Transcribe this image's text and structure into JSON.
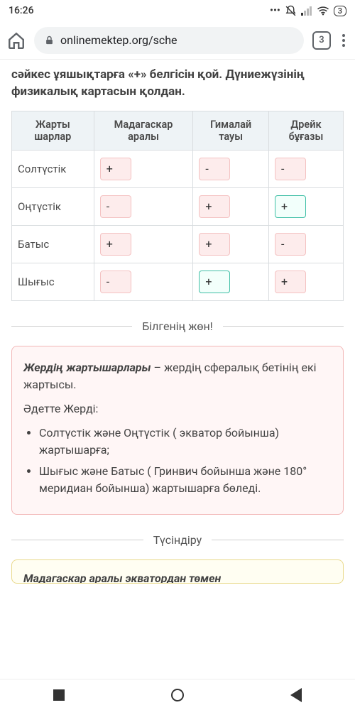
{
  "status": {
    "time": "16:26",
    "battery": "3"
  },
  "browser": {
    "url": "onlinemektep.org/sche",
    "tab_count": "3"
  },
  "instruction": "сәйкес ұяшықтарға «+» белгісін қой. Дүниежүзінің физикалық картасын қолдан.",
  "table": {
    "headers": [
      "Жарты шарлар",
      "Мадагаскар аралы",
      "Гималай тауы",
      "Дрейк бұғазы"
    ],
    "rows": [
      {
        "label": "Солтүстік",
        "cells": [
          {
            "v": "+",
            "c": false
          },
          {
            "v": "-",
            "c": false
          },
          {
            "v": "-",
            "c": false
          }
        ]
      },
      {
        "label": "Оңтүстік",
        "cells": [
          {
            "v": "-",
            "c": false
          },
          {
            "v": "+",
            "c": false
          },
          {
            "v": "+",
            "c": true
          }
        ]
      },
      {
        "label": "Батыс",
        "cells": [
          {
            "v": "+",
            "c": false
          },
          {
            "v": "+",
            "c": false
          },
          {
            "v": "-",
            "c": false
          }
        ]
      },
      {
        "label": "Шығыс",
        "cells": [
          {
            "v": "-",
            "c": false
          },
          {
            "v": "+",
            "c": true
          },
          {
            "v": "+",
            "c": false
          }
        ]
      }
    ]
  },
  "goodtoknow": {
    "title": "Білгенің жөн!",
    "term": "Жердің жартышарлары",
    "def": " – жердің сфералық бетінің екі жартысы.",
    "lead": "Әдетте Жерді:",
    "bullets": [
      "Солтүстік және Оңтүстік ( экватор бойынша) жартышарға;",
      "Шығыс және Батыс ( Гринвич бойынша және 180° меридиан бойынша) жартышарға бөледі."
    ]
  },
  "explain": {
    "title": "Түсіндіру",
    "body_term": "Мадагаскар аралы",
    "body_rest": " экватордан төмен"
  }
}
